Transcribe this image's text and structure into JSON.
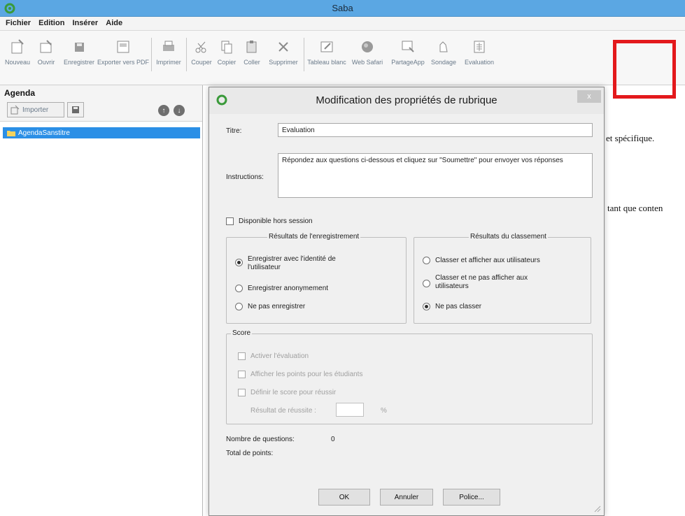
{
  "window": {
    "title": "Saba"
  },
  "menu": [
    "Fichier",
    "Edition",
    "Insérer",
    "Aide"
  ],
  "toolbar": {
    "new": "Nouveau",
    "open": "Ouvrir",
    "save": "Enregistrer",
    "export_pdf": "Exporter vers PDF",
    "print": "Imprimer",
    "cut": "Couper",
    "copy": "Copier",
    "paste": "Coller",
    "delete": "Supprimer",
    "whiteboard": "Tableau blanc",
    "web_safari": "Web Safari",
    "share_app": "PartageApp",
    "poll": "Sondage",
    "evaluation": "Evaluation"
  },
  "agenda": {
    "title": "Agenda",
    "import_label": "Importer",
    "tree_item": "AgendaSanstitre"
  },
  "background_text": {
    "line1": "et spécifique.",
    "line2": "tant que conten"
  },
  "dialog": {
    "title": "Modification des propriétés de rubrique",
    "close": "x",
    "title_label": "Titre:",
    "title_value": "Evaluation",
    "instructions_label": "Instructions:",
    "instructions_value": "Répondez aux questions ci-dessous et cliquez sur \"Soumettre\" pour envoyer vos réponses",
    "offline_label": "Disponible hors session",
    "record_group": {
      "legend": "Résultats de l'enregistrement",
      "opt1": "Enregistrer avec l'identité de l'utilisateur",
      "opt2": "Enregistrer anonymement",
      "opt3": "Ne pas enregistrer"
    },
    "ranking_group": {
      "legend": "Résultats du classement",
      "opt1": "Classer et afficher aux utilisateurs",
      "opt2": "Classer et ne pas afficher aux utilisateurs",
      "opt3": "Ne pas classer"
    },
    "score_group": {
      "legend": "Score",
      "enable": "Activer l'évaluation",
      "show_points": "Afficher les points pour les étudiants",
      "define_score": "Définir le score pour réussir",
      "pass_label": "Résultat de réussite :",
      "pass_unit": "%"
    },
    "question_count_label": "Nombre de questions:",
    "question_count": "0",
    "total_points_label": "Total de points:",
    "ok": "OK",
    "cancel": "Annuler",
    "font": "Police..."
  }
}
